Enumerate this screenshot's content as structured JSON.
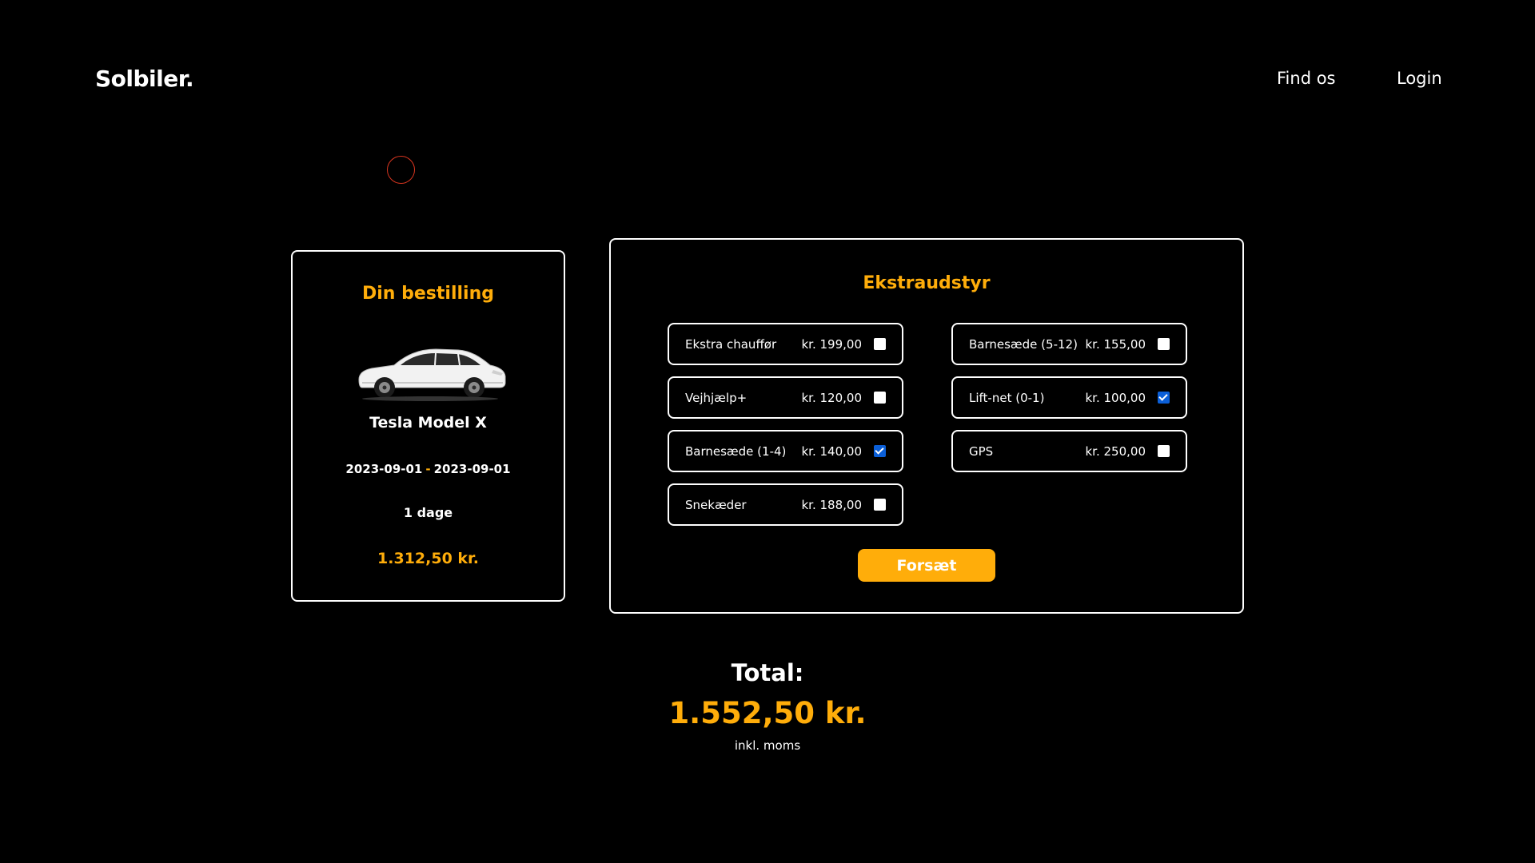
{
  "header": {
    "logo": "Solbiler.",
    "nav": {
      "find_us": "Find os",
      "login": "Login"
    }
  },
  "order": {
    "title": "Din bestilling",
    "car_name": "Tesla Model X",
    "date_from": "2023-09-01",
    "date_separator": "-",
    "date_to": "2023-09-01",
    "days": "1 dage",
    "price": "1.312,50 kr."
  },
  "extras": {
    "title": "Ekstraudstyr",
    "options": [
      {
        "label": "Ekstra chauffør",
        "price": "kr. 199,00",
        "checked": false
      },
      {
        "label": "Barnesæde (5-12)",
        "price": "kr. 155,00",
        "checked": false
      },
      {
        "label": "Vejhjælp+",
        "price": "kr. 120,00",
        "checked": false
      },
      {
        "label": "Lift-net (0-1)",
        "price": "kr. 100,00",
        "checked": true
      },
      {
        "label": "Barnesæde (1-4)",
        "price": "kr. 140,00",
        "checked": true
      },
      {
        "label": "GPS",
        "price": "kr. 250,00",
        "checked": false
      },
      {
        "label": "Snekæder",
        "price": "kr. 188,00",
        "checked": false
      }
    ],
    "continue_label": "Forsæt"
  },
  "total": {
    "label": "Total:",
    "amount": "1.552,50 kr.",
    "note": "inkl. moms"
  },
  "colors": {
    "background": "#000000",
    "accent": "#ffad0a",
    "text": "#ffffff",
    "checkbox_checked": "#0b5fd8",
    "cursor_ring": "#d9351f"
  },
  "icons": {
    "car_image": "white-suv-car-image"
  }
}
